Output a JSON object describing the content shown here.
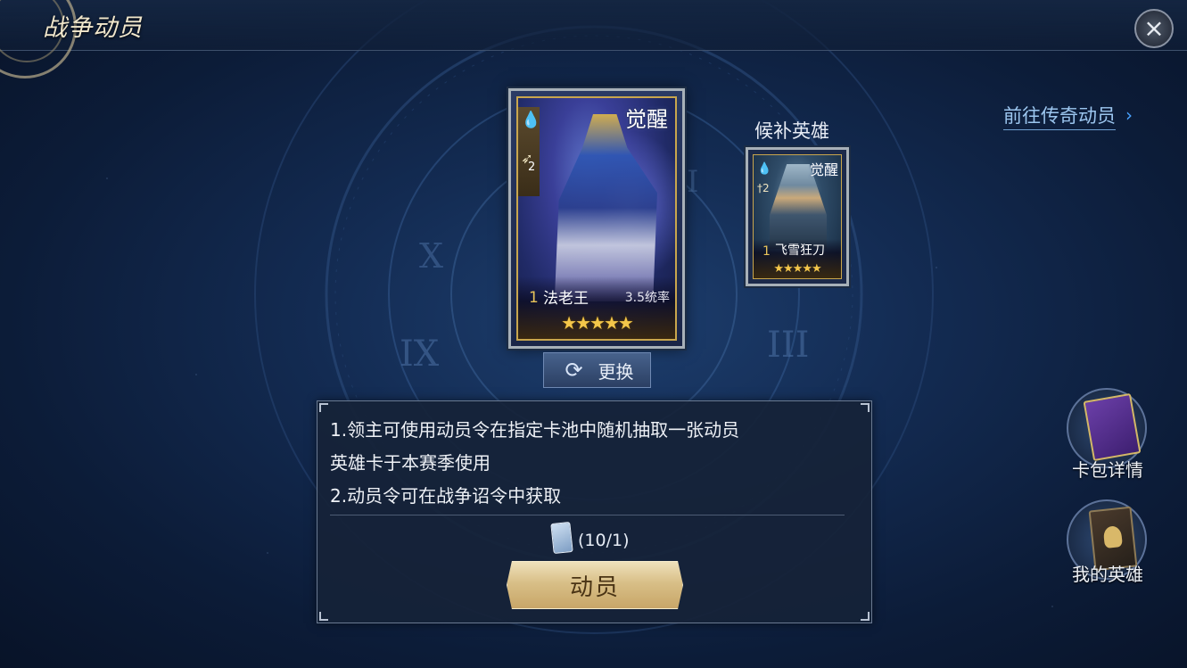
{
  "header": {
    "title": "战争动员",
    "close_icon": "close-icon"
  },
  "links": {
    "legend_mobilize": "前往传奇动员",
    "legend_arrow": "›"
  },
  "main_card": {
    "awaken_tag": "觉醒",
    "element_icon": "water-drop-icon",
    "weapon_icon": "bow-icon",
    "weapon_count": "2",
    "level": "1",
    "name": "法老王",
    "stat": "3.5统率",
    "stars": "★★★★★",
    "star_count": 5
  },
  "switch_button": {
    "label": "更换",
    "icon": "refresh-icon"
  },
  "substitute": {
    "title": "候补英雄",
    "card": {
      "awaken_tag": "觉醒",
      "element_icon": "water-drop-icon",
      "weapon_icon": "sword-icon",
      "weapon_count": "2",
      "level": "1",
      "name": "飞雪狂刀",
      "stars": "★★★★★",
      "star_count": 5
    }
  },
  "info": {
    "line1": "1.领主可使用动员令在指定卡池中随机抽取一张动员",
    "line2": "英雄卡于本赛季使用",
    "line3": "2.动员令可在战争诏令中获取",
    "token_icon": "mobilization-token-icon",
    "token_count": "(10/1)",
    "mobilize_label": "动员"
  },
  "side_buttons": {
    "card_pack": {
      "label": "卡包详情",
      "icon": "card-pack-book-icon"
    },
    "my_heroes": {
      "label": "我的英雄",
      "icon": "hero-book-icon"
    }
  },
  "colors": {
    "background": "#132b52",
    "link": "#9cc6ef",
    "gold": "#f3c64a",
    "button_gold": "#d8bf87"
  }
}
